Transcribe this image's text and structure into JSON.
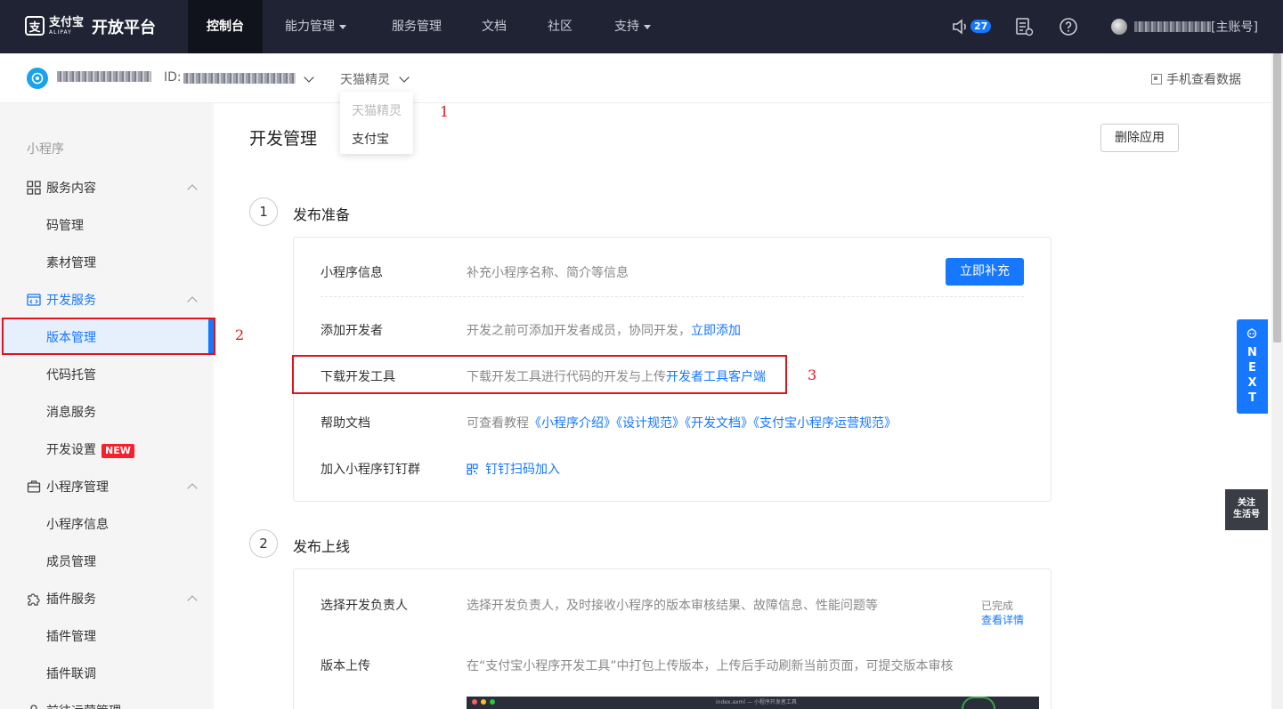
{
  "topbar": {
    "logo_cn": "支付宝",
    "logo_en": "ALIPAY",
    "platform": "开放平台",
    "nav": [
      {
        "label": "控制台",
        "active": true
      },
      {
        "label": "能力管理",
        "dropdown": true
      },
      {
        "label": "服务管理"
      },
      {
        "label": "文档"
      },
      {
        "label": "社区"
      },
      {
        "label": "支持",
        "dropdown": true
      }
    ],
    "notify_count": "27",
    "account_suffix": "[主账号]"
  },
  "subbar": {
    "id_label": "ID:",
    "platform_selected": "天猫精灵",
    "mobile_data": "手机查看数据"
  },
  "platform_dropdown": {
    "options": [
      "天猫精灵",
      "支付宝"
    ]
  },
  "sidebar": {
    "section": "小程序",
    "groups": [
      {
        "label": "服务内容",
        "items": [
          "码管理",
          "素材管理"
        ]
      },
      {
        "label": "开发服务",
        "items": [
          "版本管理",
          "代码托管",
          "消息服务",
          "开发设置"
        ]
      },
      {
        "label": "小程序管理",
        "items": [
          "小程序信息",
          "成员管理"
        ]
      },
      {
        "label": "插件服务",
        "items": [
          "插件管理",
          "插件联调"
        ]
      },
      {
        "label": "前往运营管理"
      }
    ],
    "new_badge": "NEW",
    "active_item": "版本管理"
  },
  "main": {
    "title": "开发管理",
    "delete_button": "删除应用",
    "step1": {
      "number": "1",
      "title": "发布准备",
      "rows": [
        {
          "label": "小程序信息",
          "desc": "补充小程序名称、简介等信息",
          "button": "立即补充"
        },
        {
          "label": "添加开发者",
          "desc": "开发之前可添加开发者成员，协同开发，",
          "link": "立即添加"
        },
        {
          "label": "下载开发工具",
          "desc": "下载开发工具进行代码的开发与上传",
          "link": "开发者工具客户端"
        },
        {
          "label": "帮助文档",
          "desc": "可查看教程",
          "links": [
            "《小程序介绍》",
            "《设计规范》",
            "《开发文档》",
            "《支付宝小程序运营规范》"
          ]
        },
        {
          "label": "加入小程序钉钉群",
          "link": "钉钉扫码加入"
        }
      ]
    },
    "step2": {
      "number": "2",
      "title": "发布上线",
      "rows": [
        {
          "label": "选择开发负责人",
          "desc": "选择开发负责人，及时接收小程序的版本审核结果、故障信息、性能问题等",
          "status": "已完成",
          "link": "查看详情"
        },
        {
          "label": "版本上传",
          "desc": "在“支付宝小程序开发工具”中打包上传版本，上传后手动刷新当前页面，可提交版本审核"
        }
      ],
      "preview_title": "index.axml — 小程序开发者工具"
    }
  },
  "annotations": [
    "1",
    "2",
    "3"
  ],
  "floats": {
    "next_letters": [
      "N",
      "E",
      "X",
      "T"
    ],
    "follow_line1": "关注",
    "follow_line2": "生活号"
  },
  "colors": {
    "topbar": "#1f2333",
    "accent": "#1677ff",
    "annotation": "#e0141b",
    "sidebar_bg": "#f5f5f5"
  }
}
